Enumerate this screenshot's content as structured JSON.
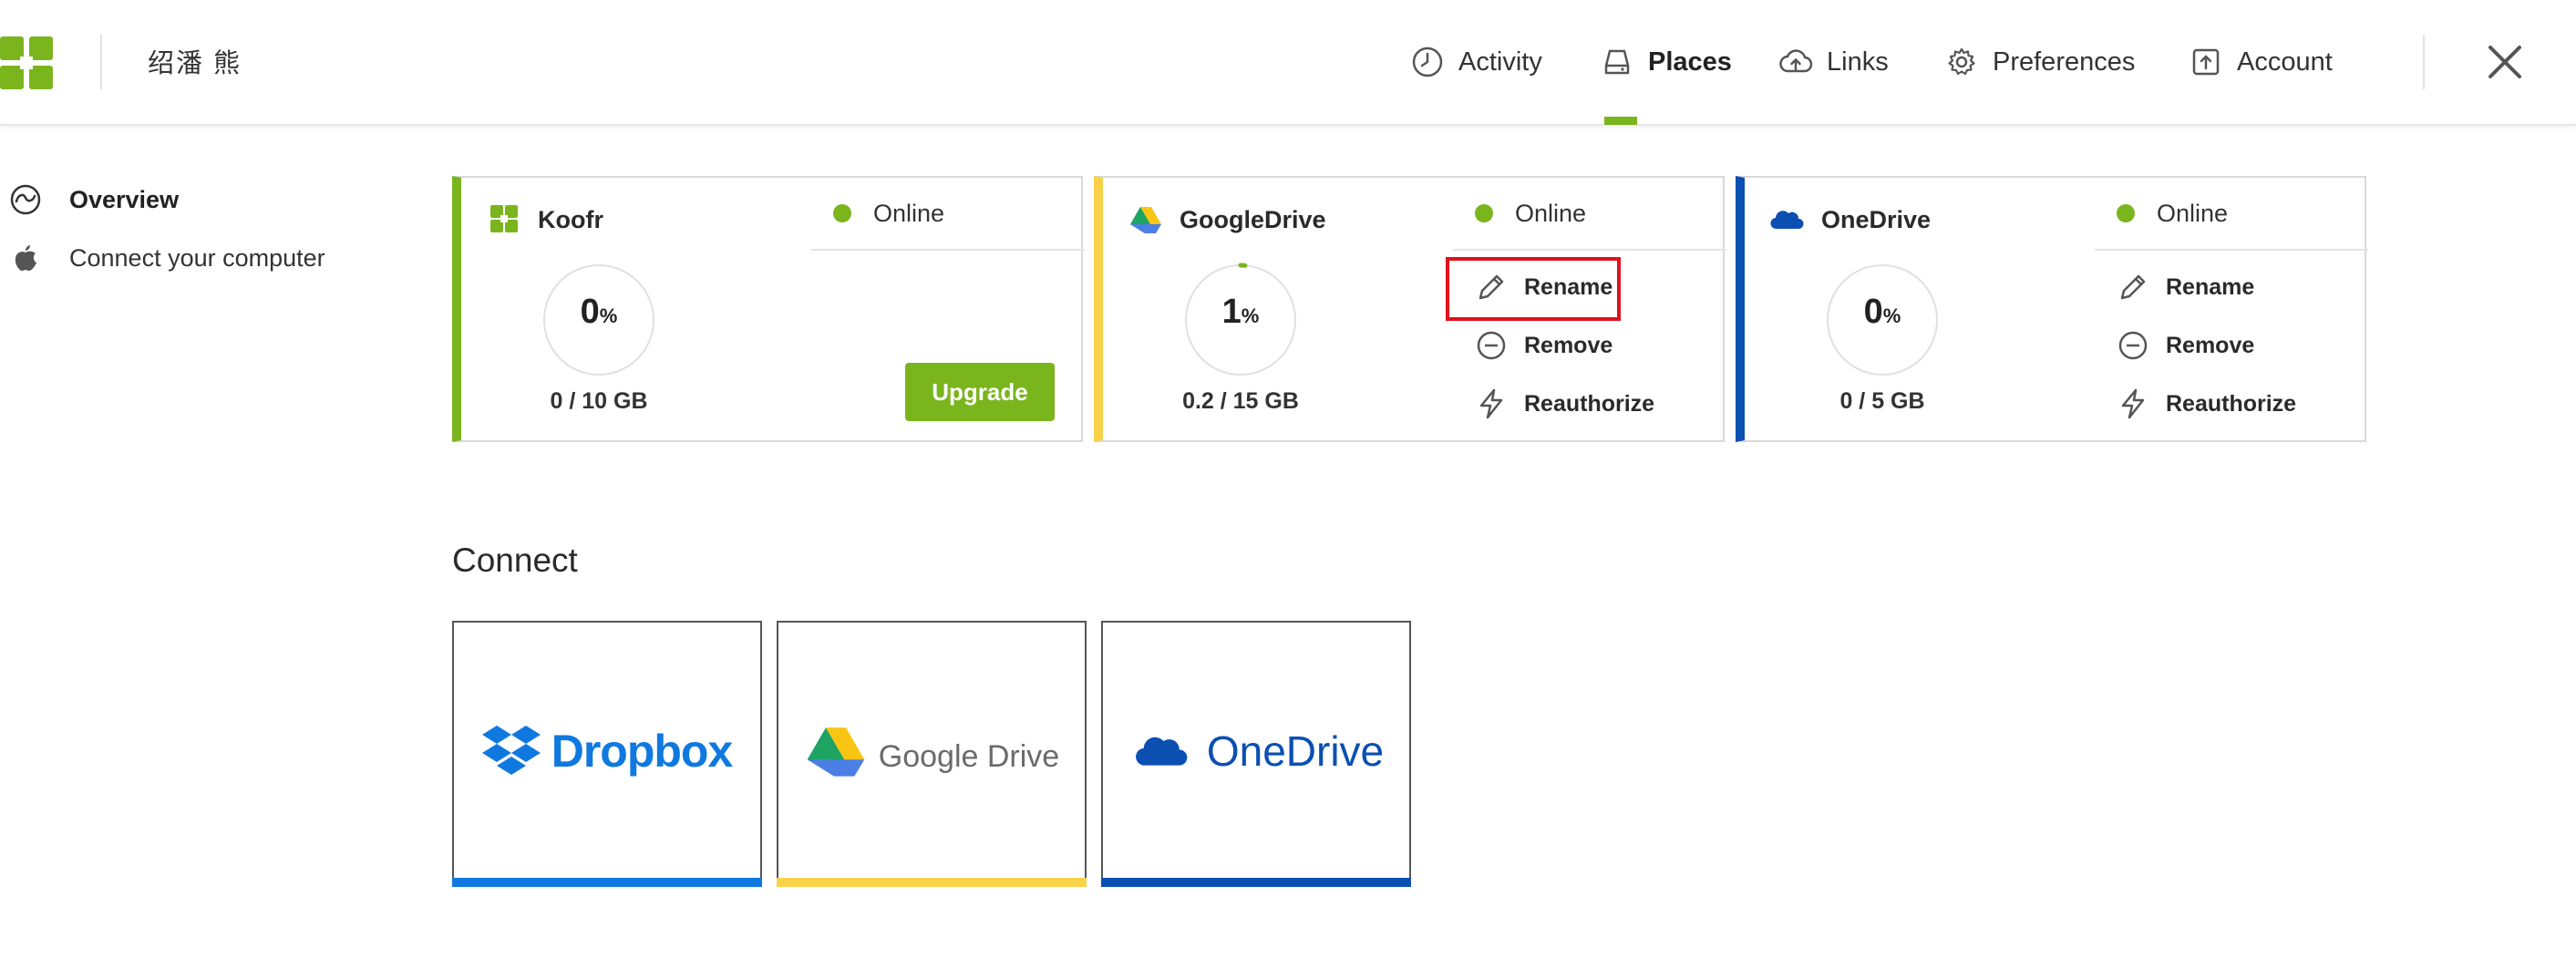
{
  "header": {
    "username": "绍潘 熊",
    "nav": [
      {
        "label": "Activity",
        "icon": "clock-icon"
      },
      {
        "label": "Places",
        "icon": "drive-icon",
        "active": true
      },
      {
        "label": "Links",
        "icon": "cloud-upload-icon"
      },
      {
        "label": "Preferences",
        "icon": "gear-icon"
      },
      {
        "label": "Account",
        "icon": "account-icon"
      }
    ],
    "accent": "#7ab51d"
  },
  "sidebar": {
    "items": [
      {
        "label": "Overview",
        "icon": "overview-icon",
        "active": true
      },
      {
        "label": "Connect your computer",
        "icon": "apple-icon"
      }
    ]
  },
  "places": [
    {
      "name": "Koofr",
      "status": "Online",
      "percent": "0",
      "percent_unit": "%",
      "usage": "0 / 10 GB",
      "fraction": 0,
      "color": "#7ab51d",
      "button": "Upgrade"
    },
    {
      "name": "GoogleDrive",
      "status": "Online",
      "percent": "1",
      "percent_unit": "%",
      "usage": "0.2 / 15 GB",
      "fraction": 0.013,
      "color": "#f9d24a",
      "actions": [
        "Rename",
        "Remove",
        "Reauthorize"
      ]
    },
    {
      "name": "OneDrive",
      "status": "Online",
      "percent": "0",
      "percent_unit": "%",
      "usage": "0 / 5 GB",
      "fraction": 0,
      "color": "#0b4fb3",
      "actions": [
        "Rename",
        "Remove",
        "Reauthorize"
      ]
    }
  ],
  "connect": {
    "title": "Connect",
    "services": [
      {
        "name": "Dropbox",
        "color": "#0f79e0"
      },
      {
        "name": "Google Drive",
        "color": "#f9d24a"
      },
      {
        "name": "OneDrive",
        "color": "#0b4fb3"
      }
    ]
  }
}
